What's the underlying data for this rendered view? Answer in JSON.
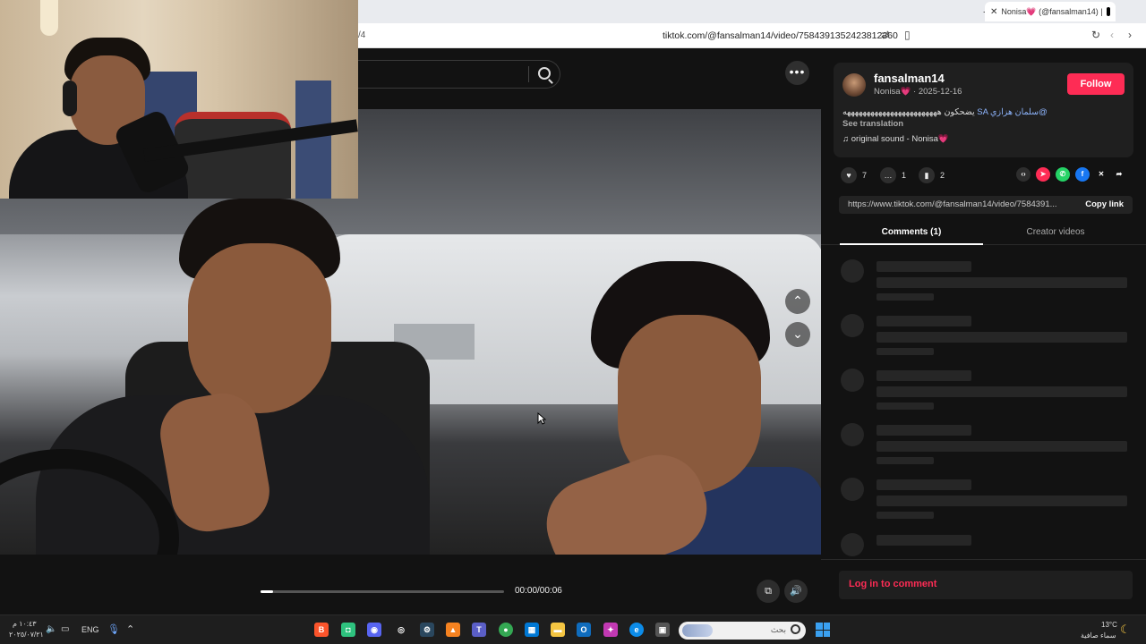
{
  "browser": {
    "tab_title": "Nonisa💗 (@fansalman14) |",
    "url": "tiktok.com/@fansalman14/video/7584391352423812360",
    "url_left_fragment": "/4"
  },
  "video": {
    "time": "00:00/00:06",
    "progress": 0.05
  },
  "creator": {
    "username": "fansalman14",
    "display_name": "Nonisa💗",
    "date": "2025-12-16",
    "follow_label": "Follow",
    "caption_tag": "SA سلمان هزازي@",
    "caption_text": "يضحكون ههههههههههههههههههههههههه",
    "see_translation": "See translation",
    "sound": "original sound - Nonisa💗"
  },
  "actions": {
    "likes": "7",
    "comments": "1",
    "saves": "2"
  },
  "link": {
    "url": "https://www.tiktok.com/@fansalman14/video/7584391...",
    "copy_label": "Copy link"
  },
  "tabs": {
    "comments": "Comments (1)",
    "creator_videos": "Creator videos"
  },
  "login_label": "Log in to comment",
  "taskbar": {
    "time": "١٠:٤٣ م",
    "date": "٢٠٢٥/٠٧/٢١",
    "lang": "ENG",
    "search_placeholder": "بحث",
    "temp": "13°C",
    "weather": "سماء صافية"
  },
  "colors": {
    "accent": "#fe2c55",
    "page_bg": "#121212"
  }
}
